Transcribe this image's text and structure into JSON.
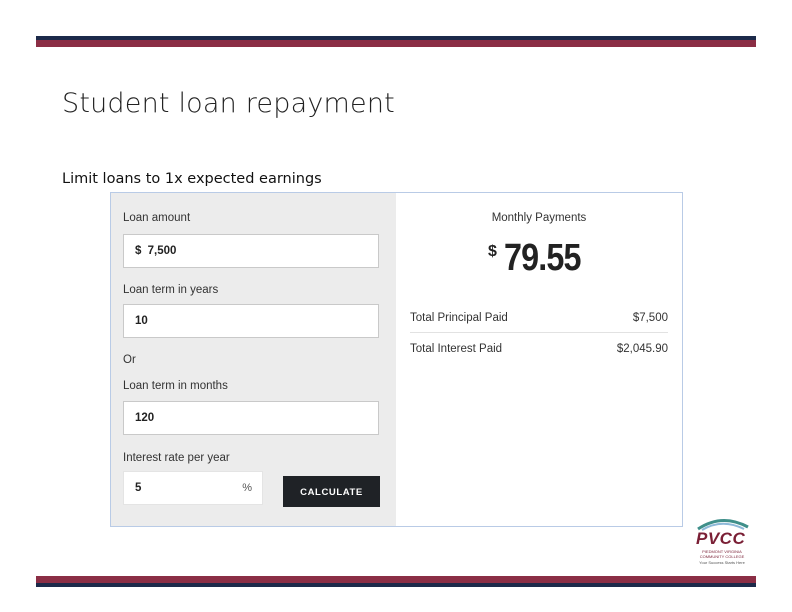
{
  "slide": {
    "title": "Student loan repayment",
    "subtitle": "Limit loans to 1x expected earnings"
  },
  "calculator": {
    "loan_amount": {
      "label": "Loan amount",
      "currency": "$",
      "value": "7,500"
    },
    "loan_term_years": {
      "label": "Loan term in years",
      "value": "10"
    },
    "or_label": "Or",
    "loan_term_months": {
      "label": "Loan term in months",
      "value": "120"
    },
    "interest_rate": {
      "label": "Interest rate per year",
      "value": "5",
      "unit": "%"
    },
    "calculate_label": "CALCULATE"
  },
  "results": {
    "monthly_label": "Monthly Payments",
    "currency": "$",
    "monthly_value": "79.55",
    "rows": [
      {
        "label": "Total Principal Paid",
        "value": "$7,500"
      },
      {
        "label": "Total Interest Paid",
        "value": "$2,045.90"
      }
    ]
  },
  "logo": {
    "word": "PVCC",
    "line1": "PIEDMONT VIRGINIA",
    "line2": "COMMUNITY COLLEGE",
    "line3": "Your Success Starts Here"
  },
  "colors": {
    "navy": "#1c2a4a",
    "maroon": "#8b2e45",
    "button": "#1f2226",
    "panel": "#ececec"
  }
}
